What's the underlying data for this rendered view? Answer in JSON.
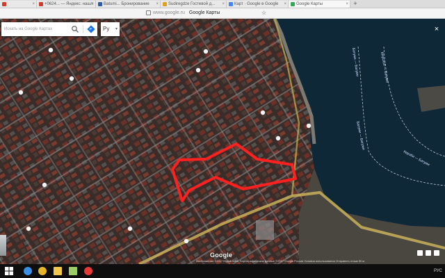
{
  "browser": {
    "tabs": [
      {
        "label": "",
        "favicon_color": "#d23b2f",
        "active": false
      },
      {
        "label": "+0624... — Яндекс: нашл",
        "favicon_color": "#d23b2f",
        "active": false
      },
      {
        "label": "Batumi... Бронирование",
        "favicon_color": "#2e5aa8",
        "active": false
      },
      {
        "label": "Sudiregdze Гостевой д...",
        "favicon_color": "#e0a020",
        "active": false
      },
      {
        "label": "Карт · Google в Google",
        "favicon_color": "#4285f4",
        "active": false
      },
      {
        "label": "Google Карты",
        "favicon_color": "#34a853",
        "active": true
      }
    ],
    "new_tab_label": "+",
    "address": {
      "host": "www.google.ru",
      "title": "Google Карты"
    }
  },
  "search": {
    "placeholder": "Искать на Google Картах"
  },
  "layer_button": {
    "label": "Ру"
  },
  "map": {
    "labels": [
      {
        "text": "Батуми — Батуми",
        "color": "#cfe0ff"
      },
      {
        "text": "Морской — Батуми",
        "color": "#cfe0ff"
      },
      {
        "text": "Батуми — Батуми",
        "color": "#cfe0ff"
      },
      {
        "text": "Кероби — Батуми",
        "color": "#cfe0ff"
      }
    ],
    "highlight_color": "#ff2020",
    "water_color": "#0f2838"
  },
  "attribution": {
    "text": "Изображения ©2017 DigitalGlobe, Картографические данные ©2017 Google   Россия   Условия использования   Отправить отзыв   50 м"
  },
  "google_logo": "Google",
  "taskbar": {
    "icons": [
      {
        "name": "edge-icon",
        "color": "#3a8ee6"
      },
      {
        "name": "chrome-icon",
        "color": "#e5b52a"
      },
      {
        "name": "explorer-icon",
        "color": "#f2c94c"
      },
      {
        "name": "file-icon",
        "color": "#9ccc65"
      },
      {
        "name": "yandex-icon",
        "color": "#e53935"
      }
    ],
    "tray_text": "РУС"
  }
}
